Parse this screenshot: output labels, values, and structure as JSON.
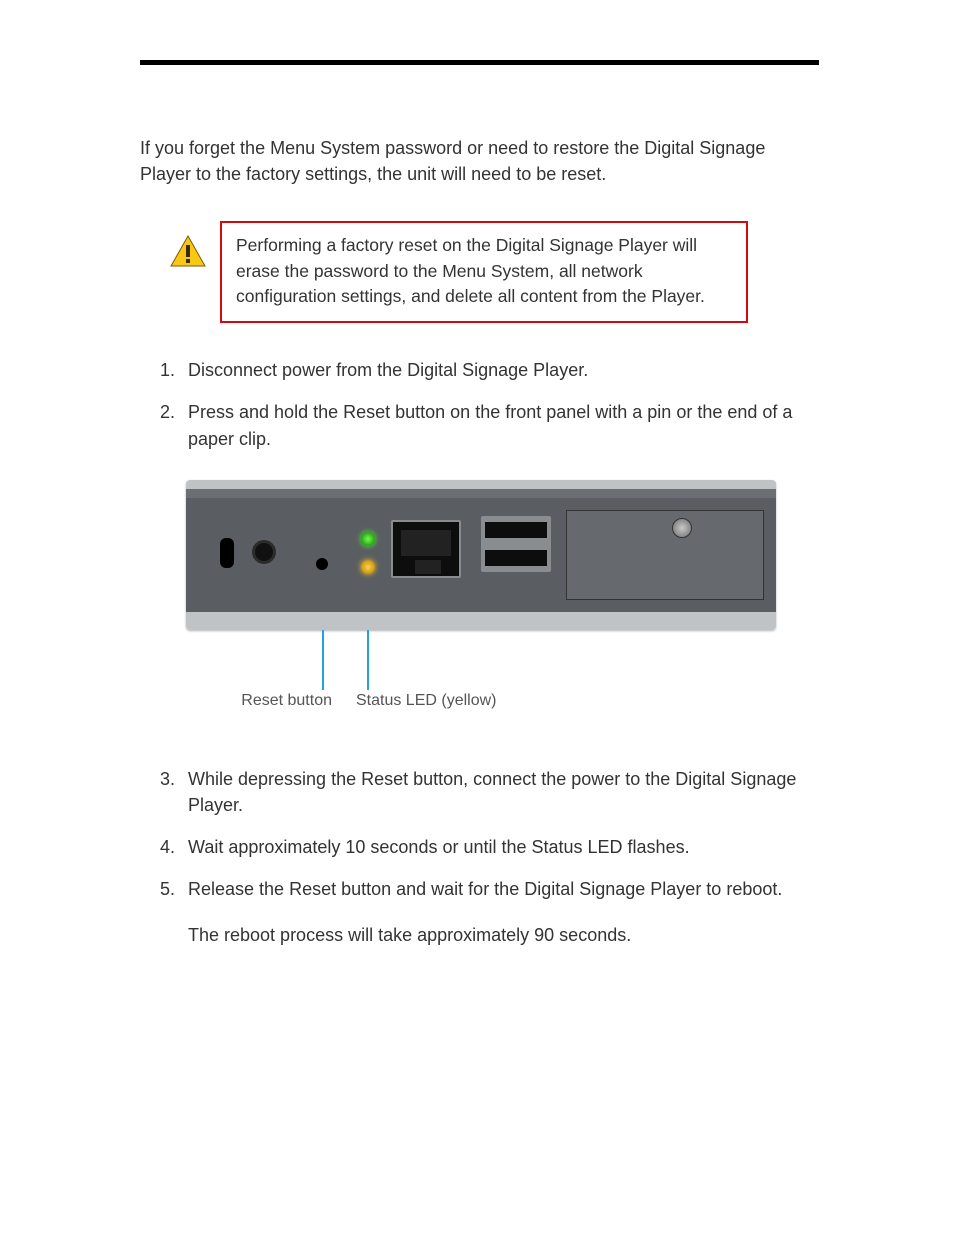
{
  "intro": "If you forget the Menu System password or need to restore the Digital Signage Player to the factory settings, the unit will need to be reset.",
  "warning": {
    "text": "Performing a factory reset on the Digital Signage Player will erase the password to the Menu System, all network configuration settings, and delete all content from the Player."
  },
  "steps": [
    {
      "num": "1.",
      "text": "Disconnect power from the Digital Signage Player."
    },
    {
      "num": "2.",
      "text": "Press and hold the Reset button on the front panel with a pin or the end of a paper clip."
    },
    {
      "num": "3.",
      "text": "While depressing the Reset button, connect the power to the Digital Signage Player."
    },
    {
      "num": "4.",
      "text": "Wait approximately 10 seconds or until the Status LED flashes."
    },
    {
      "num": "5.",
      "text": "Release the Reset button and wait for the Digital Signage Player to reboot."
    }
  ],
  "callouts": {
    "reset": "Reset button",
    "status_led": "Status LED (yellow)"
  },
  "after_note": "The reboot process will take approximately 90 seconds."
}
